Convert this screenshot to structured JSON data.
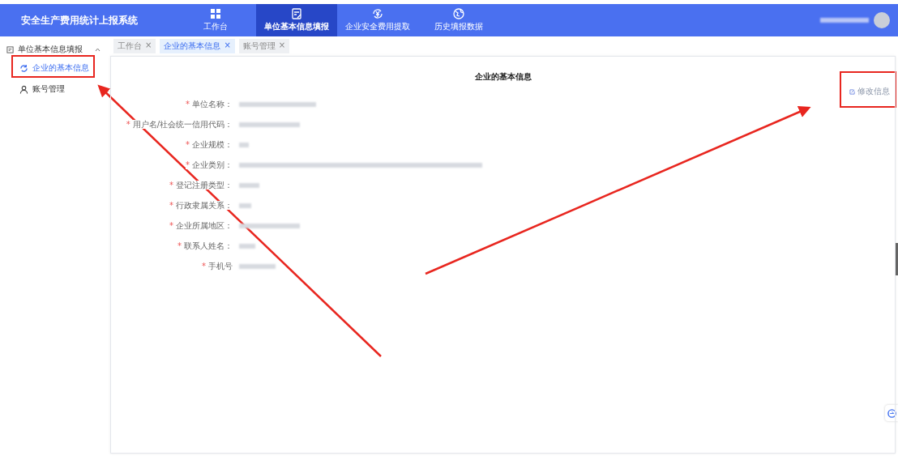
{
  "header": {
    "title": "安全生产费用统计上报系统",
    "nav": [
      {
        "label": "工作台",
        "selected": false
      },
      {
        "label": "单位基本信息填报",
        "selected": true
      },
      {
        "label": "企业安全费用提取",
        "selected": false
      },
      {
        "label": "历史填报数据",
        "selected": false
      }
    ]
  },
  "sidebar": {
    "group": {
      "label": "单位基本信息填报",
      "expanded": true,
      "children": [
        {
          "label": "企业的基本信息",
          "selected": true
        },
        {
          "label": "账号管理",
          "selected": false
        }
      ]
    }
  },
  "tabs": [
    {
      "label": "工作台",
      "close": "×",
      "selected": false
    },
    {
      "label": "企业的基本信息",
      "close": "×",
      "selected": true
    },
    {
      "label": "账号管理",
      "close": "×",
      "selected": false
    }
  ],
  "card": {
    "title": "企业的基本信息",
    "edit_button": "修改信息",
    "fields": [
      {
        "label": "单位名称：",
        "required_mark": "*"
      },
      {
        "label": "用户名/社会统一信用代码：",
        "required_mark": "*"
      },
      {
        "label": "企业规模：",
        "required_mark": "*"
      },
      {
        "label": "企业类别：",
        "required_mark": "*"
      },
      {
        "label": "登记注册类型：",
        "required_mark": "*"
      },
      {
        "label": "行政隶属关系：",
        "required_mark": "*"
      },
      {
        "label": "企业所属地区：",
        "required_mark": "*"
      },
      {
        "label": "联系人姓名：",
        "required_mark": "*"
      },
      {
        "label": "手机号",
        "required_mark": "*"
      }
    ]
  }
}
